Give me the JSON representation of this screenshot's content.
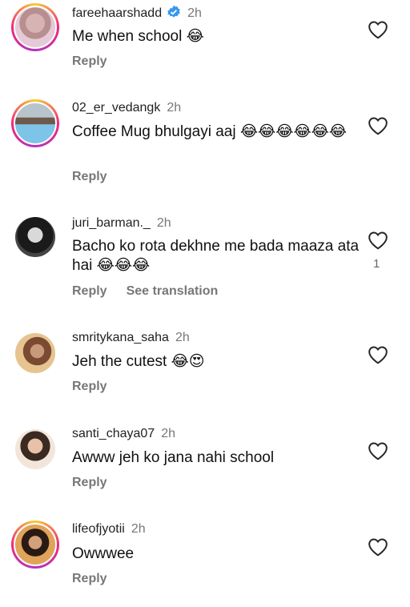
{
  "comments": [
    {
      "username": "fareehaarshadd",
      "verified": true,
      "time": "2h",
      "text": "Me when school 😂",
      "reply": "Reply"
    },
    {
      "username": "02_er_vedangk",
      "time": "2h",
      "text": "Coffee Mug bhulgayi aaj 😂😂😂😂😂😂",
      "reply": "Reply"
    },
    {
      "username": "juri_barman._",
      "time": "2h",
      "text": "Bacho ko rota dekhne me bada maaza ata hai 😂😂😂",
      "reply": "Reply",
      "translation": "See translation",
      "likes": "1"
    },
    {
      "username": "smritykana_saha",
      "time": "2h",
      "text": "Jeh the cutest 😂😍",
      "reply": "Reply"
    },
    {
      "username": "santi_chaya07",
      "time": "2h",
      "text": "Awww jeh ko jana nahi school",
      "reply": "Reply"
    },
    {
      "username": "lifeofjyotii",
      "time": "2h",
      "text": "Owwwee",
      "reply": "Reply"
    }
  ],
  "icons": {
    "heart": "heart-outline-icon",
    "verified": "verified-badge-icon"
  },
  "colors": {
    "verified_blue": "#3797f0",
    "muted": "#777777"
  }
}
